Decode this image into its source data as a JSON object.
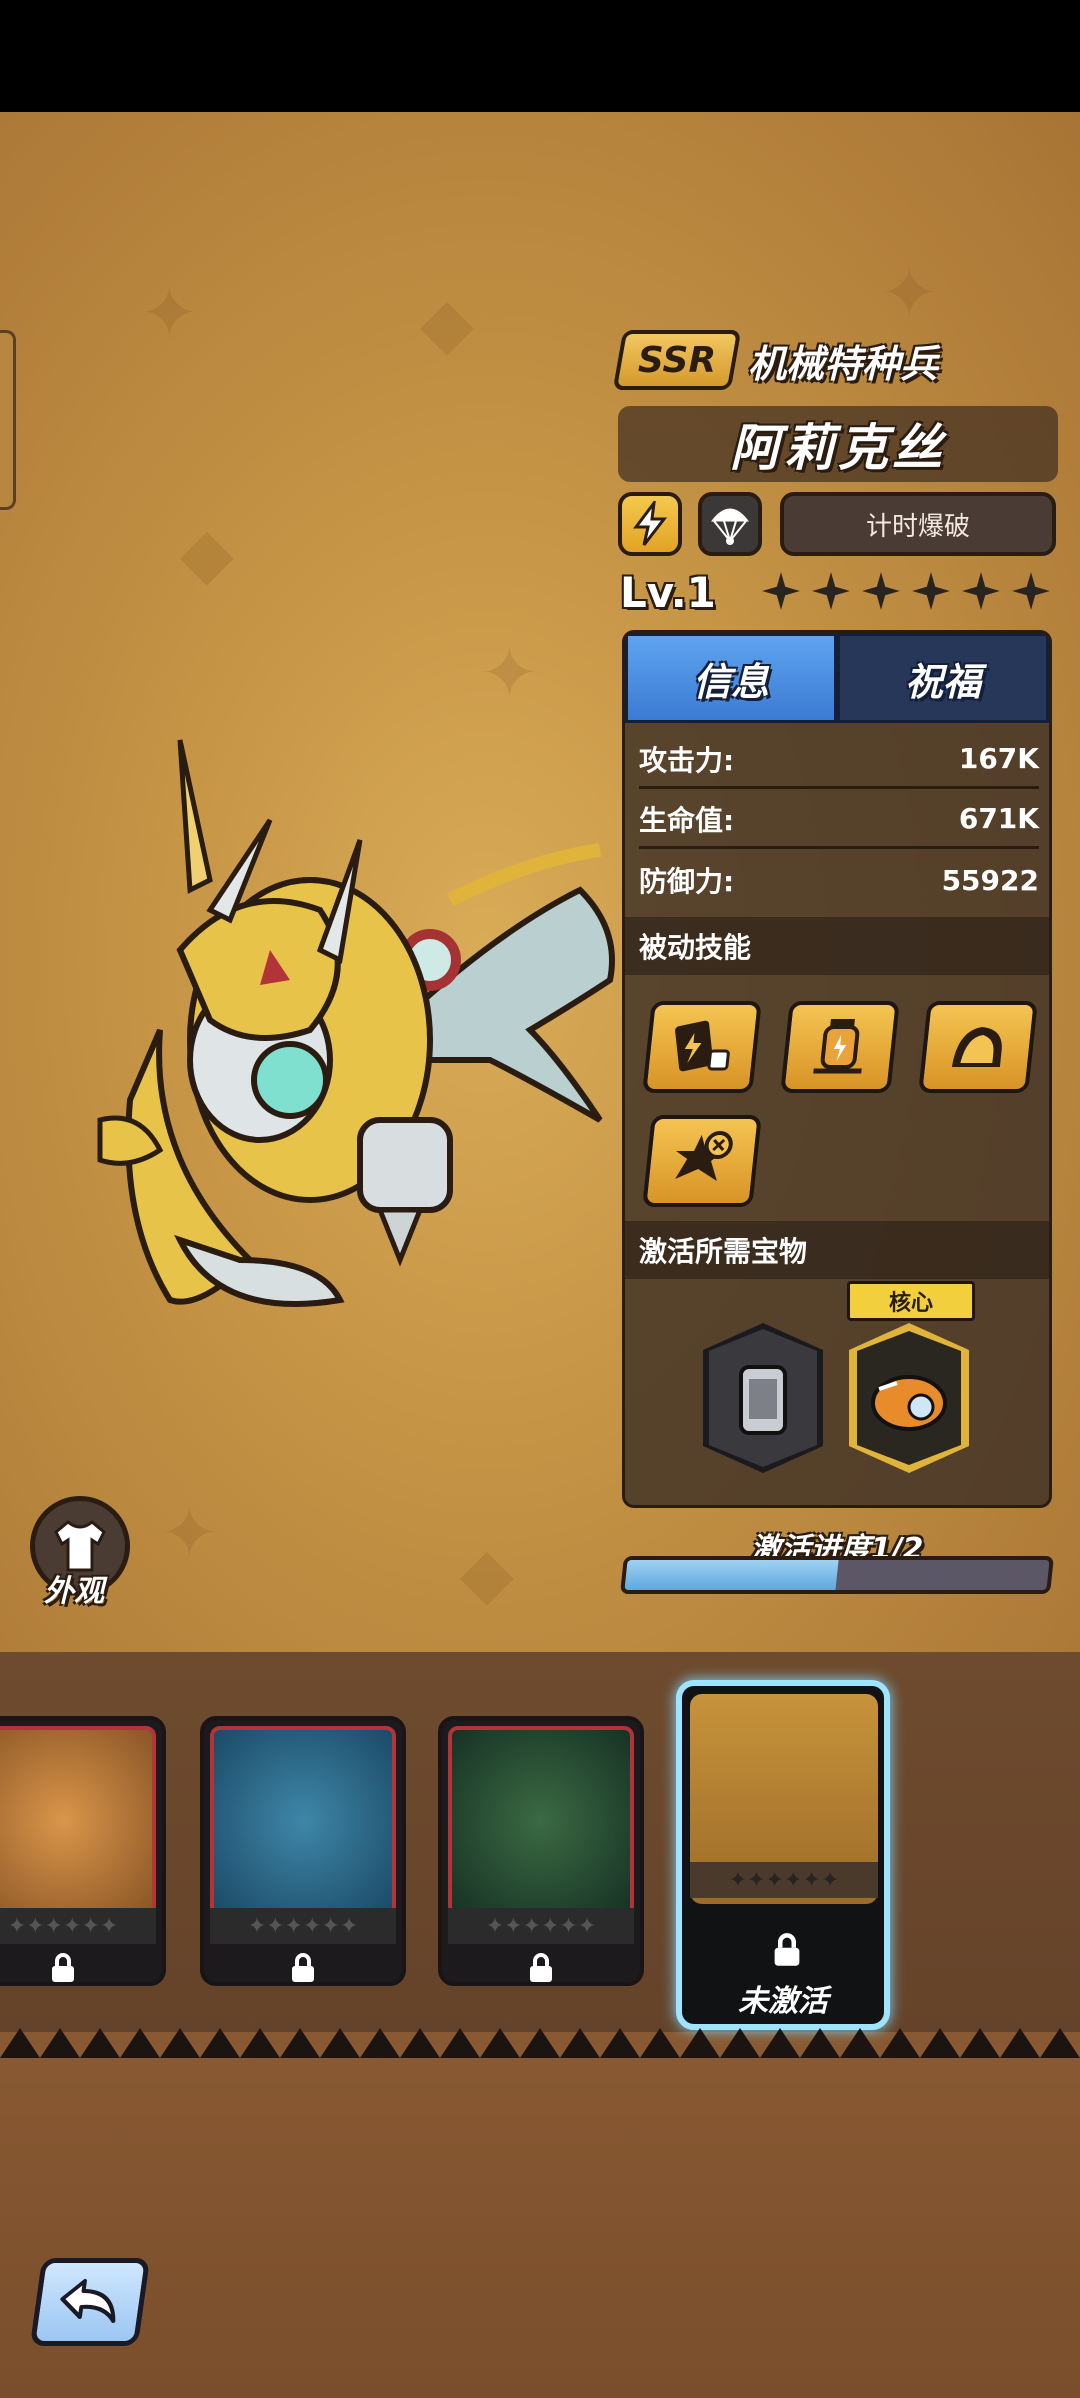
{
  "header": {
    "rarity": "SSR",
    "class_name": "机械特种兵",
    "hero_name": "阿莉克丝",
    "skill_tag": "计时爆破",
    "level": "Lv.1",
    "stars_total": 6
  },
  "tabs": [
    {
      "label": "信息",
      "active": true
    },
    {
      "label": "祝福",
      "active": false
    }
  ],
  "stats": [
    {
      "label": "攻击力:",
      "value": "167K"
    },
    {
      "label": "生命值:",
      "value": "671K"
    },
    {
      "label": "防御力:",
      "value": "55922"
    }
  ],
  "passive_title": "被动技能",
  "passive_skills": [
    "card-dice-icon",
    "lantern-icon",
    "armor-icon",
    "explosion-timer-icon"
  ],
  "treasure_title": "激活所需宝物",
  "treasures": [
    {
      "icon": "canister-icon",
      "core": false
    },
    {
      "icon": "cannon-icon",
      "core": true
    }
  ],
  "core_label": "核心",
  "progress": {
    "label": "激活进度1/2",
    "fraction": 0.5
  },
  "appearance_label": "外观",
  "roster": [
    {
      "name": "pumpkin-hero",
      "locked": true
    },
    {
      "name": "dragon-skull-hero",
      "locked": true
    },
    {
      "name": "green-beast-hero",
      "locked": true
    },
    {
      "name": "mech-dragon-hero",
      "locked": false,
      "selected": true,
      "status": "未激活"
    }
  ],
  "colors": {
    "accent_blue": "#3b7bd3",
    "gold": "#f1c760",
    "panel": "#3e3026"
  }
}
